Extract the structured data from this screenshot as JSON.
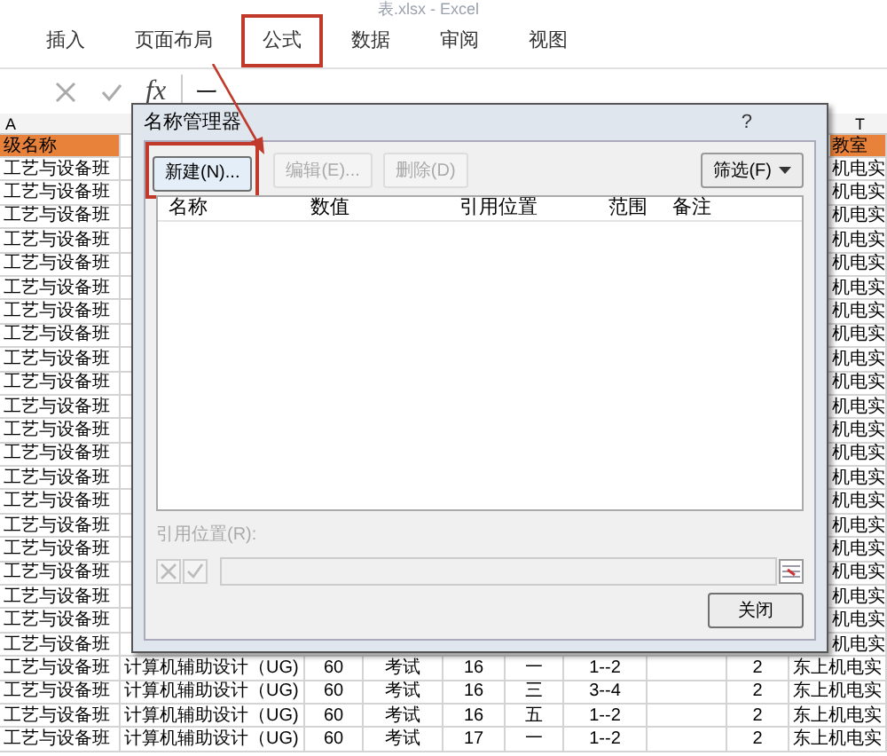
{
  "window": {
    "title": "表.xlsx - Excel"
  },
  "ribbon_tabs": [
    {
      "label": "插入",
      "highlighted": false
    },
    {
      "label": "页面布局",
      "highlighted": false
    },
    {
      "label": "公式",
      "highlighted": true
    },
    {
      "label": "数据",
      "highlighted": false
    },
    {
      "label": "审阅",
      "highlighted": false
    },
    {
      "label": "视图",
      "highlighted": false
    }
  ],
  "formula_bar": {
    "function_label": "fx",
    "value": "一"
  },
  "column_headers": [
    "A",
    "T"
  ],
  "sheet": {
    "header": {
      "first": "级名称",
      "last": "教室"
    },
    "rows": [
      {
        "kind": "partial",
        "first": "工艺与设备班",
        "last": "机电实"
      },
      {
        "kind": "partial",
        "first": "工艺与设备班",
        "last": "机电实"
      },
      {
        "kind": "partial",
        "first": "工艺与设备班",
        "last": "机电实"
      },
      {
        "kind": "partial",
        "first": "工艺与设备班",
        "last": "机电实"
      },
      {
        "kind": "partial",
        "first": "工艺与设备班",
        "last": "机电实"
      },
      {
        "kind": "partial",
        "first": "工艺与设备班",
        "last": "机电实"
      },
      {
        "kind": "partial",
        "first": "工艺与设备班",
        "last": "机电实"
      },
      {
        "kind": "partial",
        "first": "工艺与设备班",
        "last": "机电实"
      },
      {
        "kind": "partial",
        "first": "工艺与设备班",
        "last": "机电实"
      },
      {
        "kind": "partial",
        "first": "工艺与设备班",
        "last": "机电实"
      },
      {
        "kind": "partial",
        "first": "工艺与设备班",
        "last": "机电实"
      },
      {
        "kind": "partial",
        "first": "工艺与设备班",
        "last": "机电实"
      },
      {
        "kind": "partial",
        "first": "工艺与设备班",
        "last": "机电实"
      },
      {
        "kind": "partial",
        "first": "工艺与设备班",
        "last": "机电实"
      },
      {
        "kind": "partial",
        "first": "工艺与设备班",
        "last": "机电实"
      },
      {
        "kind": "partial",
        "first": "工艺与设备班",
        "last": "机电实"
      },
      {
        "kind": "partial",
        "first": "工艺与设备班",
        "last": "机电实"
      },
      {
        "kind": "partial",
        "first": "工艺与设备班",
        "last": "机电实"
      },
      {
        "kind": "partial",
        "first": "工艺与设备班",
        "last": "机电实"
      },
      {
        "kind": "partial",
        "first": "工艺与设备班",
        "last": "机电实"
      },
      {
        "kind": "partial",
        "first": "工艺与设备班",
        "last": "机电实"
      },
      {
        "kind": "full",
        "cells": [
          "工艺与设备班",
          "计算机辅助设计（UG)",
          "60",
          "考试",
          "16",
          "一",
          "1--2",
          "2",
          "东上机电实"
        ]
      },
      {
        "kind": "full",
        "cells": [
          "工艺与设备班",
          "计算机辅助设计（UG)",
          "60",
          "考试",
          "16",
          "三",
          "3--4",
          "2",
          "东上机电实"
        ]
      },
      {
        "kind": "full",
        "cells": [
          "工艺与设备班",
          "计算机辅助设计（UG)",
          "60",
          "考试",
          "16",
          "五",
          "1--2",
          "2",
          "东上机电实"
        ]
      },
      {
        "kind": "full",
        "cells": [
          "工艺与设备班",
          "计算机辅助设计（UG)",
          "60",
          "考试",
          "17",
          "一",
          "1--2",
          "2",
          "东上机电实"
        ]
      }
    ]
  },
  "dialog": {
    "title": "名称管理器",
    "help": "?",
    "buttons": [
      {
        "label": "新建(N)...",
        "disabled": false,
        "highlighted": true
      },
      {
        "label": "编辑(E)...",
        "disabled": true,
        "highlighted": false
      },
      {
        "label": "删除(D)",
        "disabled": true,
        "highlighted": false
      }
    ],
    "filter_button": "筛选(F)",
    "list_columns": [
      "名称",
      "数值",
      "引用位置",
      "范围",
      "备注"
    ],
    "reference_label": "引用位置(R):",
    "reference_disabled": true,
    "close_button": "关闭"
  }
}
